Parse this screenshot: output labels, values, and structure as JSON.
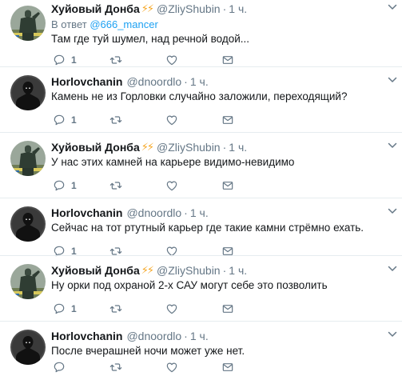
{
  "tweets": [
    {
      "name": "Хуйовый Донба",
      "bolts": "⚡⚡",
      "handle": "@ZliyShubin",
      "time": "1 ч.",
      "reply_prefix": "В ответ ",
      "reply_handle": "@666_mancer",
      "text": "Там где туй шумел, над речной водой...",
      "reply_count": "1",
      "avatar": "soldier-statue"
    },
    {
      "name": "Horlovchanin",
      "handle": "@dnoordlo",
      "time": "1 ч.",
      "text": "Камень не из Горловки случайно заложили, переходящий?",
      "reply_count": "1",
      "avatar": "dark-figure"
    },
    {
      "name": "Хуйовый Донба",
      "bolts": "⚡⚡",
      "handle": "@ZliyShubin",
      "time": "1 ч.",
      "text": "У нас этих камней на карьере видимо-невидимо",
      "reply_count": "1",
      "avatar": "soldier-statue"
    },
    {
      "name": "Horlovchanin",
      "handle": "@dnoordlo",
      "time": "1 ч.",
      "text": "Сейчас на тот ртутный карьер где такие камни стрёмно ехать.",
      "reply_count": "1",
      "avatar": "dark-figure"
    },
    {
      "name": "Хуйовый Донба",
      "bolts": "⚡⚡",
      "handle": "@ZliyShubin",
      "time": "1 ч.",
      "text": "Ну орки под охраной 2-х САУ могут себе это позволить",
      "reply_count": "1",
      "avatar": "soldier-statue"
    },
    {
      "name": "Horlovchanin",
      "handle": "@dnoordlo",
      "time": "1 ч.",
      "text": "После вчерашней ночи может уже нет.",
      "reply_count": "",
      "avatar": "dark-figure"
    }
  ],
  "icons": {
    "reply": "reply-icon",
    "retweet": "retweet-icon",
    "like": "heart-icon",
    "message": "envelope-icon",
    "more": "chevron-down-icon"
  },
  "colors": {
    "name": "#14171a",
    "secondary": "#657786",
    "link": "#1da1f2",
    "bolt": "#f5a623",
    "separator": "#e6ecf0"
  }
}
